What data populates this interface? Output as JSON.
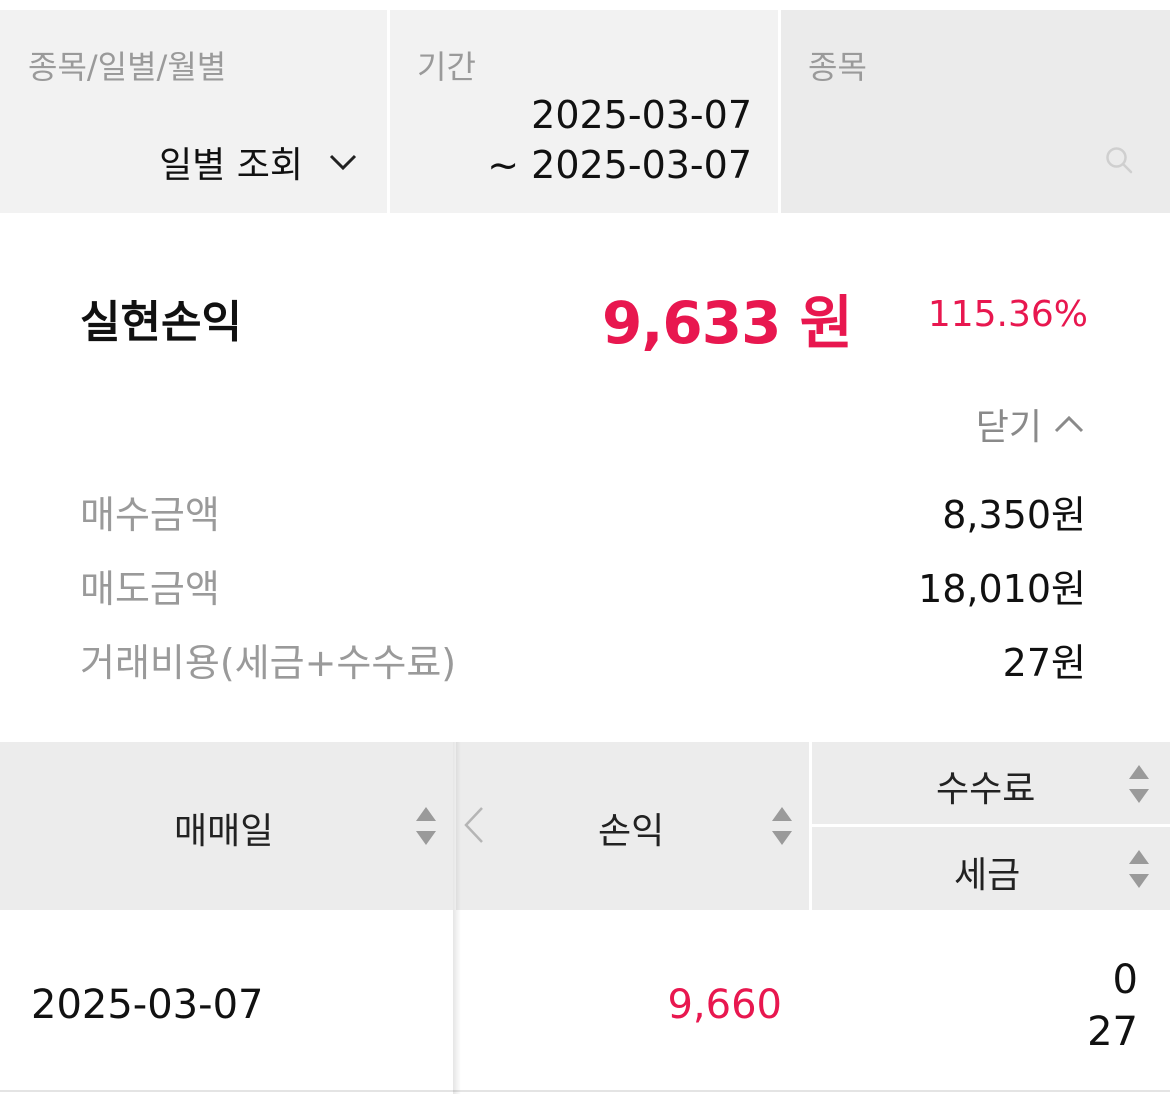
{
  "filters": {
    "type": {
      "label": "종목/일별/월별",
      "value": "일별 조회"
    },
    "period": {
      "label": "기간",
      "start": "2025-03-07",
      "end": "~ 2025-03-07"
    },
    "stock": {
      "label": "종목",
      "placeholder": ""
    }
  },
  "summary": {
    "title": "실현손익",
    "amount": "9,633 원",
    "rate": "115.36%",
    "close_label": "닫기",
    "details": [
      {
        "label": "매수금액",
        "value": "8,350원"
      },
      {
        "label": "매도금액",
        "value": "18,010원"
      },
      {
        "label": "거래비용(세금+수수료)",
        "value": "27원"
      }
    ]
  },
  "table": {
    "headers": {
      "date": "매매일",
      "profit_loss": "손익",
      "fee": "수수료",
      "tax": "세금"
    },
    "rows": [
      {
        "date": "2025-03-07",
        "profit_loss": "9,660",
        "fee": "0",
        "tax": "27"
      }
    ]
  },
  "colors": {
    "positive": "#e8174f",
    "header_bg": "#ececec",
    "filter_bg": "#f2f2f2",
    "muted_text": "#9a9a9a"
  },
  "icons": {
    "type_dropdown": "chevron-down-icon",
    "stock_search": "search-icon",
    "close_toggle": "chevron-up-icon",
    "sort": "sort-icon",
    "scroll_left": "chevron-left-icon"
  }
}
